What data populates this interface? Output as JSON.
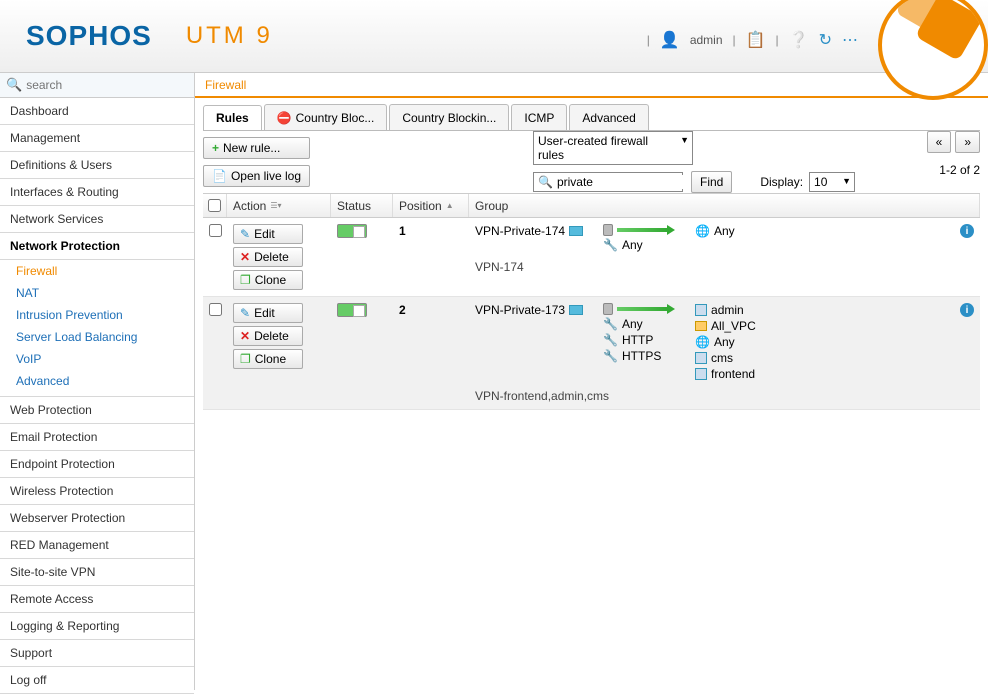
{
  "header": {
    "logo": "SOPHOS",
    "product": "UTM 9",
    "username": "admin"
  },
  "search": {
    "placeholder": "search"
  },
  "sidebar": {
    "items": [
      {
        "label": "Dashboard"
      },
      {
        "label": "Management"
      },
      {
        "label": "Definitions & Users"
      },
      {
        "label": "Interfaces & Routing"
      },
      {
        "label": "Network Services"
      },
      {
        "label": "Network Protection",
        "active": true
      },
      {
        "label": "Web Protection"
      },
      {
        "label": "Email Protection"
      },
      {
        "label": "Endpoint Protection"
      },
      {
        "label": "Wireless Protection"
      },
      {
        "label": "Webserver Protection"
      },
      {
        "label": "RED Management"
      },
      {
        "label": "Site-to-site VPN"
      },
      {
        "label": "Remote Access"
      },
      {
        "label": "Logging & Reporting"
      },
      {
        "label": "Support"
      },
      {
        "label": "Log off"
      }
    ],
    "subitems": [
      {
        "label": "Firewall",
        "active": true
      },
      {
        "label": "NAT"
      },
      {
        "label": "Intrusion Prevention"
      },
      {
        "label": "Server Load Balancing"
      },
      {
        "label": "VoIP"
      },
      {
        "label": "Advanced"
      }
    ]
  },
  "breadcrumb": "Firewall",
  "tabs": [
    {
      "label": "Rules",
      "active": true
    },
    {
      "label": "Country Bloc...",
      "blocked": true
    },
    {
      "label": "Country Blockin..."
    },
    {
      "label": "ICMP"
    },
    {
      "label": "Advanced"
    }
  ],
  "toolbar": {
    "new_rule": "New rule...",
    "open_log": "Open live log",
    "filter_dropdown": "User-created firewall rules",
    "search_value": "private",
    "find": "Find",
    "display_label": "Display:",
    "display_value": "10",
    "count_label": "1-2 of 2",
    "prev": "«",
    "next": "»"
  },
  "columns": {
    "action": "Action",
    "status": "Status",
    "position": "Position",
    "group": "Group"
  },
  "action_labels": {
    "edit": "Edit",
    "delete": "Delete",
    "clone": "Clone"
  },
  "rules": [
    {
      "position": "1",
      "source": "VPN-Private-174",
      "services": [
        "Any"
      ],
      "destinations": [
        {
          "label": "Any",
          "type": "globe"
        }
      ],
      "name": "VPN-174"
    },
    {
      "position": "2",
      "source": "VPN-Private-173",
      "services": [
        "Any",
        "HTTP",
        "HTTPS"
      ],
      "destinations": [
        {
          "label": "admin",
          "type": "host"
        },
        {
          "label": "All_VPC",
          "type": "folder"
        },
        {
          "label": "Any",
          "type": "globe"
        },
        {
          "label": "cms",
          "type": "host"
        },
        {
          "label": "frontend",
          "type": "host"
        }
      ],
      "name": "VPN-frontend,admin,cms"
    }
  ]
}
